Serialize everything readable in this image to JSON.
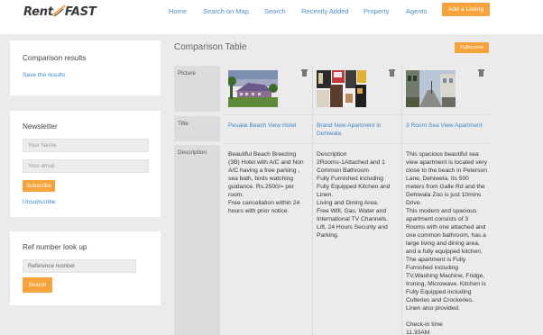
{
  "header": {
    "logo": {
      "part1": "Rent",
      "part2": "FAST",
      "icon": "swoosh-icon"
    },
    "nav": [
      "Home",
      "Search on Map",
      "Search",
      "Recently Added",
      "Property",
      "Agents"
    ],
    "add_listing": "Add a Listing"
  },
  "sidebar": {
    "comparison": {
      "title": "Comparison results",
      "save": "Save the results"
    },
    "newsletter": {
      "title": "Newsletter",
      "name_placeholder": "Your Name",
      "email_placeholder": "Your email",
      "subscribe": "Subscribe",
      "unsubscribe": "Unsubscribe"
    },
    "ref": {
      "title": "Ref number look up",
      "placeholder": "Reference number",
      "search": "Search"
    }
  },
  "main": {
    "title": "Comparison Table",
    "fullscreen": "Fullscreen",
    "rows": {
      "picture": "Picture",
      "title": "Title",
      "description": "Description"
    },
    "properties": [
      {
        "title": "Pesalai Beach View Hotel",
        "description": "Beautiful Beach Breezing (3B) Hotel with A/C and Non A/C having a free parking , sea bath, birds watching guidance. Rs.2500/= per room.\nFree cancellation within 24 hours with prior notice.",
        "picture_icon": "hotel-photo"
      },
      {
        "title": "Brand New Apartment in Dehiwala",
        "description": "Description\n2Rooms-1Attached and 1 Common Bathroom\nFully Furnished including Fully Equipped Kitchen and Linen.\nLiving and Dining Area.\nFree Wifi, Gas, Water and International TV Channels.\nLift, 24 Hours Security and Parking.",
        "picture_icon": "apartment-collage-photo"
      },
      {
        "title": "3 Room Sea View Apartment",
        "description": "This spacious beautiful sea view apartment is located very close to the beach in Peterson Lane, Dehiwela. Its 500 meters from Galle Rd and the Dehiwala Zoo is just 10mins Drive.\nThis modern and spacious apartment consists of 3 Rooms with one attached and one common bathroom, has a large living and dining area, and a fully equipped kitchen. The apartment is Fully Furnished including TV,Washing Machine, Fridge, Ironing, Microwave. Kitchen is Fully Equipped including Cutleries and Crockeries. Linen also provided.\n\nCheck-in time\n11.30AM",
        "picture_icon": "street-photo"
      }
    ]
  },
  "colors": {
    "accent": "#f5a33a",
    "link": "#3d87c9",
    "nav": "#4f8fc9"
  }
}
